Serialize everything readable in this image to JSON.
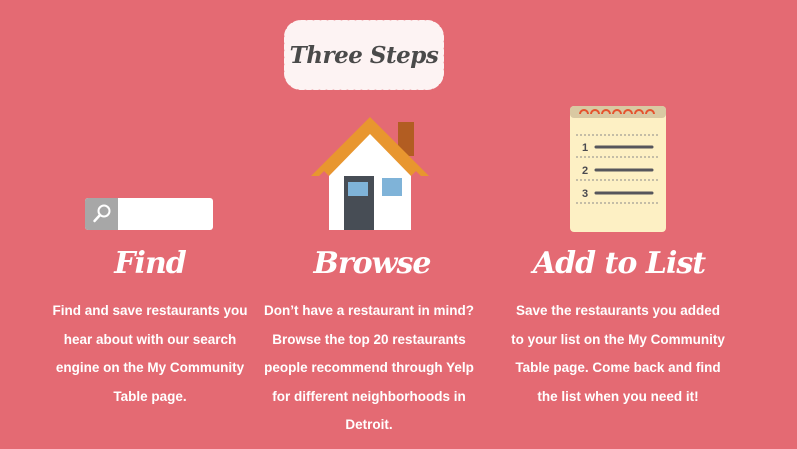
{
  "header": {
    "title": "Three Steps"
  },
  "steps": [
    {
      "title": "Find",
      "icon": "search-bar-icon",
      "lines": [
        "Find and save restaurants you",
        "hear about with our search",
        "engine on the My Community",
        "Table page."
      ]
    },
    {
      "title": "Browse",
      "icon": "house-icon",
      "lines": [
        "Don’t have a restaurant in mind?",
        "Browse the top 20 restaurants",
        "people recommend through Yelp",
        "for different neighborhoods in",
        "Detroit."
      ]
    },
    {
      "title": "Add to List",
      "icon": "notepad-icon",
      "notepad_numbers": [
        "1",
        "2",
        "3"
      ],
      "lines": [
        "Save the restaurants you added",
        "to your list on the My Community",
        "Table page. Come back and find",
        "the list when you need it!"
      ]
    }
  ],
  "colors": {
    "background": "#e46a73",
    "badge_fill": "#fdf3f3",
    "house_roof": "#e8962f",
    "notepad_paper": "#fdf0c4",
    "notepad_rings": "#e5532e"
  }
}
